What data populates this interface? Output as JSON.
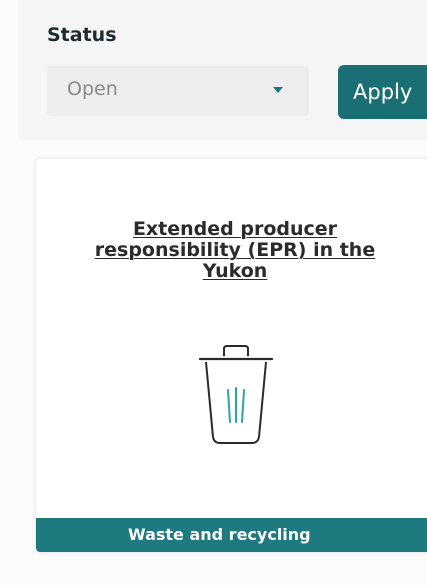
{
  "filter": {
    "status_label": "Status",
    "status_value": "Open",
    "apply_label": "Apply"
  },
  "card": {
    "title_line1": "Extended producer",
    "title_line2": "responsibility (EPR) in the",
    "title_line3": "Yukon",
    "icon": "trash-can-icon",
    "category": "Waste and recycling"
  },
  "colors": {
    "accent": "#1a6f75",
    "category_bar": "#1f7a80",
    "icon_stroke": "#2b2b2b",
    "icon_accent": "#2aa6a0"
  }
}
